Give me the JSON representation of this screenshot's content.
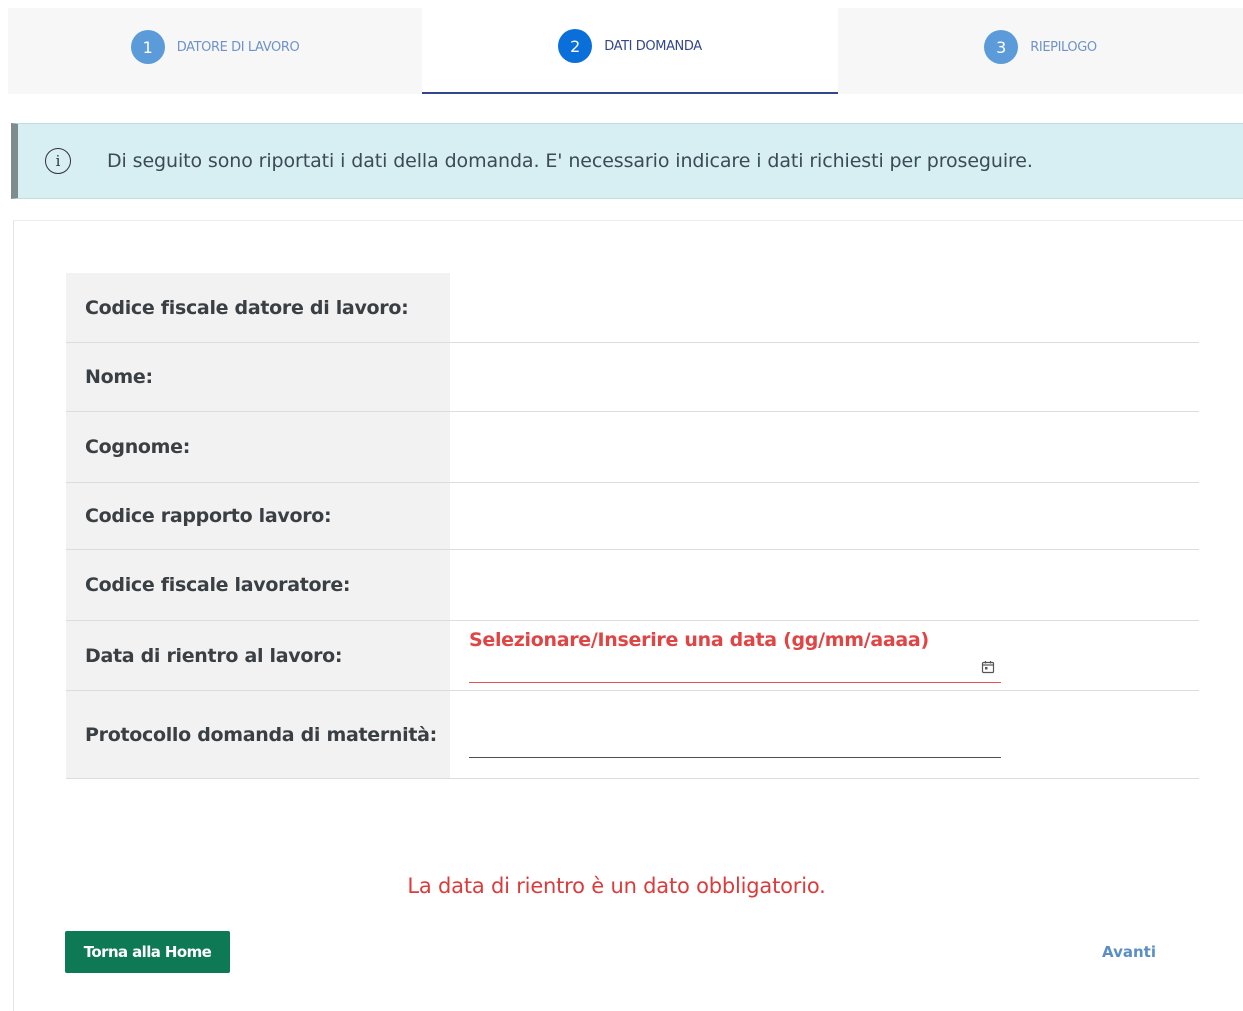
{
  "stepper": {
    "steps": [
      {
        "number": "1",
        "label": "DATORE DI LAVORO"
      },
      {
        "number": "2",
        "label": "DATI DOMANDA"
      },
      {
        "number": "3",
        "label": "RIEPILOGO"
      }
    ],
    "active_step": 2
  },
  "banner": {
    "icon": "info-icon",
    "glyph": "i",
    "message": "Di seguito sono riportati i dati della domanda. E' necessario indicare i dati richiesti per proseguire."
  },
  "form": {
    "rows": [
      {
        "label": "Codice fiscale datore di lavoro:",
        "value": ""
      },
      {
        "label": "Nome:",
        "value": ""
      },
      {
        "label": "Cognome:",
        "value": ""
      },
      {
        "label": "Codice rapporto lavoro:",
        "value": ""
      },
      {
        "label": "Codice fiscale lavoratore:",
        "value": ""
      },
      {
        "label": "Data di rientro al lavoro:",
        "field_label": "Selezionare/Inserire una data (gg/mm/aaaa)",
        "value": ""
      },
      {
        "label": "Protocollo domanda di maternità:",
        "value": ""
      }
    ]
  },
  "error_message": "La data di rientro è un dato obbligatorio.",
  "actions": {
    "home_label": "Torna alla Home",
    "next_label": "Avanti"
  },
  "colors": {
    "error": "#e04545",
    "primary_button": "#0e7a55",
    "banner_bg": "#d7eef2"
  }
}
